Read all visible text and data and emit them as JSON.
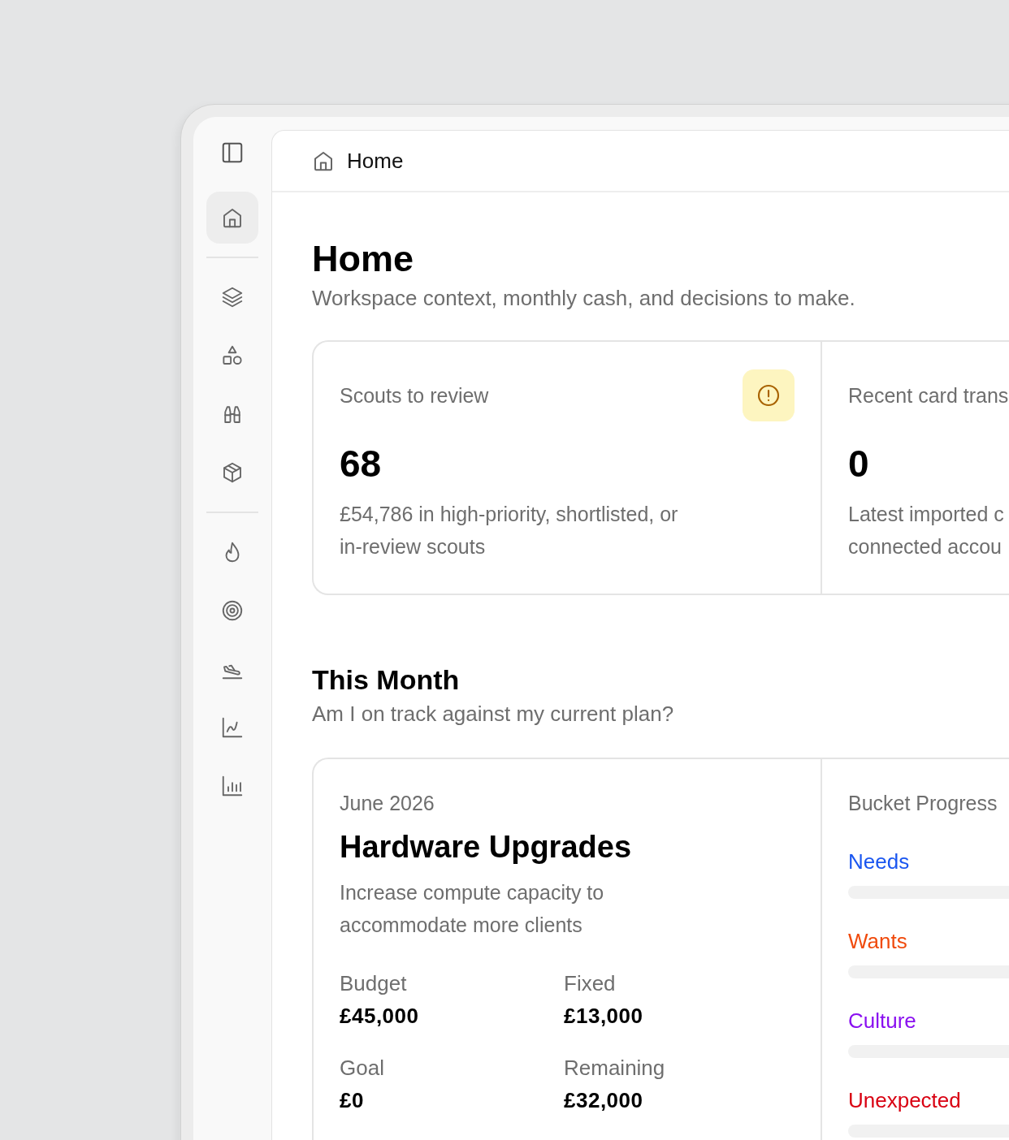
{
  "sidebar": {
    "groups": [
      [
        {
          "selected": true
        }
      ],
      [
        {
          "selected": false
        },
        {
          "selected": false
        },
        {
          "selected": false
        },
        {
          "selected": false
        }
      ],
      [
        {
          "selected": false
        },
        {
          "selected": false
        },
        {
          "selected": false
        },
        {
          "selected": false
        },
        {
          "selected": false
        }
      ]
    ]
  },
  "breadcrumb": {
    "label": "Home"
  },
  "page": {
    "title": "Home",
    "subtitle": "Workspace context, monthly cash, and decisions to make."
  },
  "metrics": [
    {
      "label": "Scouts to review",
      "value": "68",
      "alert": true,
      "description_lines": [
        "£54,786 in high-priority, shortlisted, or",
        "in-review scouts"
      ]
    },
    {
      "label": "Recent card trans",
      "value": "0",
      "alert": false,
      "description_lines": [
        "Latest imported c",
        "connected accou"
      ]
    }
  ],
  "this_month": {
    "title": "This Month",
    "subtitle": "Am I on track against my current plan?",
    "plan": {
      "date": "June 2026",
      "title": "Hardware Upgrades",
      "description_lines": [
        "Increase compute capacity to",
        "accommodate more clients"
      ],
      "stats": [
        {
          "label": "Budget",
          "value": "£45,000"
        },
        {
          "label": "Fixed",
          "value": "£13,000"
        },
        {
          "label": "Goal",
          "value": "£0"
        },
        {
          "label": "Remaining",
          "value": "£32,000"
        }
      ]
    },
    "buckets": {
      "title": "Bucket Progress",
      "items": [
        {
          "name": "Needs",
          "color": "#1a56f0"
        },
        {
          "name": "Wants",
          "color": "#f04a0c"
        },
        {
          "name": "Culture",
          "color": "#8a10f0"
        },
        {
          "name": "Unexpected",
          "color": "#d90012"
        }
      ]
    }
  }
}
